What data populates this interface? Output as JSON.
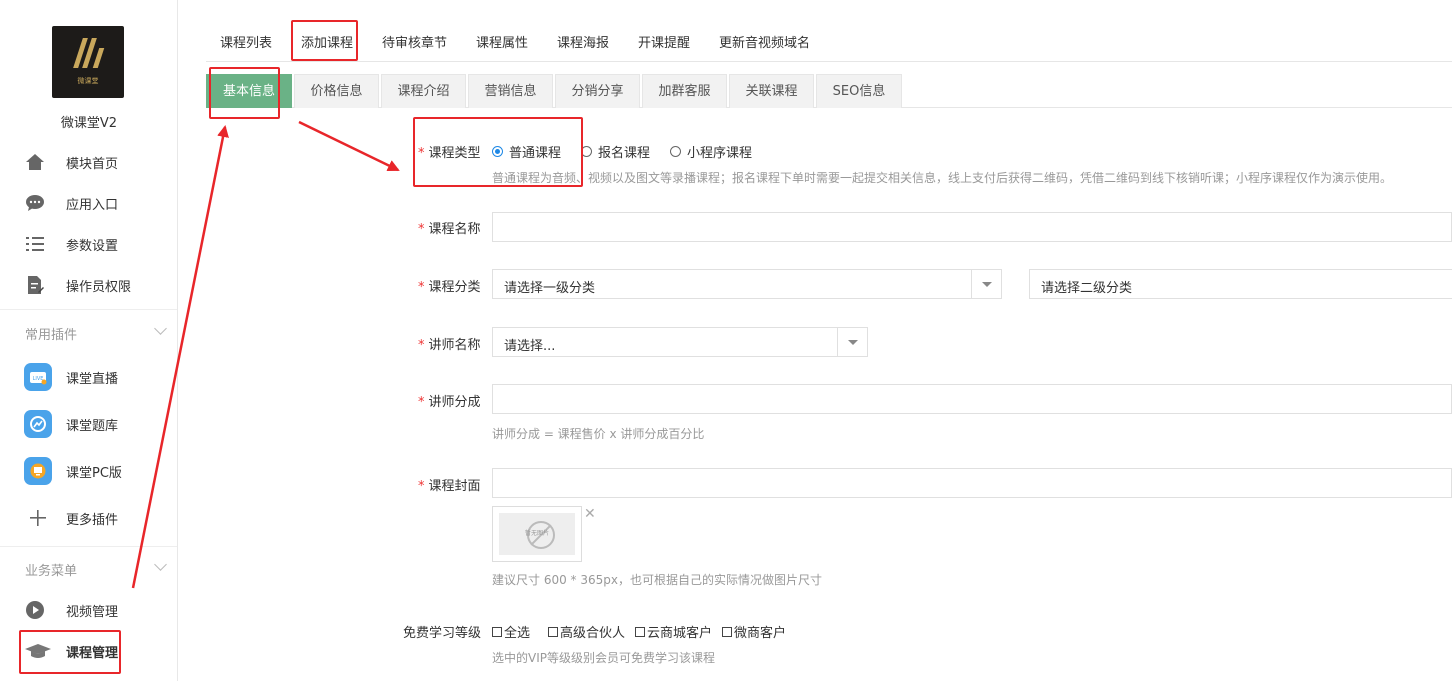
{
  "sidebar": {
    "logo_caption": "微课堂",
    "app_name": "微课堂V2",
    "main_items": [
      {
        "label": "模块首页",
        "icon": "home-icon"
      },
      {
        "label": "应用入口",
        "icon": "chat-icon"
      },
      {
        "label": "参数设置",
        "icon": "list-icon"
      },
      {
        "label": "操作员权限",
        "icon": "document-edit-icon"
      }
    ],
    "section_plugins": "常用插件",
    "plugin_items": [
      {
        "label": "课堂直播",
        "icon": "live-tv-icon"
      },
      {
        "label": "课堂题库",
        "icon": "question-bank-icon"
      },
      {
        "label": "课堂PC版",
        "icon": "monitor-icon"
      },
      {
        "label": "更多插件",
        "icon": "plus-icon"
      }
    ],
    "section_business": "业务菜单",
    "business_items": [
      {
        "label": "视频管理",
        "icon": "play-icon"
      },
      {
        "label": "课程管理",
        "icon": "graduation-cap-icon"
      }
    ]
  },
  "top_tabs": [
    "课程列表",
    "添加课程",
    "待审核章节",
    "课程属性",
    "课程海报",
    "开课提醒",
    "更新音视频域名"
  ],
  "sub_tabs": [
    "基本信息",
    "价格信息",
    "课程介绍",
    "营销信息",
    "分销分享",
    "加群客服",
    "关联课程",
    "SEO信息"
  ],
  "form": {
    "course_type": {
      "label": "课程类型",
      "options": [
        "普通课程",
        "报名课程",
        "小程序课程"
      ],
      "selected": "普通课程",
      "hint": "普通课程为音频、视频以及图文等录播课程；报名课程下单时需要一起提交相关信息，线上支付后获得二维码，凭借二维码到线下核销听课；小程序课程仅作为演示使用。"
    },
    "course_name": {
      "label": "课程名称",
      "value": ""
    },
    "category": {
      "label": "课程分类",
      "level1": "请选择一级分类",
      "level2": "请选择二级分类"
    },
    "teacher_name": {
      "label": "讲师名称",
      "value": "请选择..."
    },
    "teacher_share": {
      "label": "讲师分成",
      "value": "",
      "hint": "讲师分成 = 课程售价 x 讲师分成百分比"
    },
    "cover": {
      "label": "课程封面",
      "value": "",
      "placeholder_text": "暂无图片",
      "hint": "建议尺寸 600 * 365px，也可根据自己的实际情况做图片尺寸"
    },
    "free_level": {
      "label": "免费学习等级",
      "options": [
        "全选",
        "高级合伙人",
        "云商城客户",
        "微商客户"
      ],
      "hint": "选中的VIP等级级别会员可免费学习该课程"
    }
  },
  "colors": {
    "active_tab": "#6ab286",
    "required": "#e33333",
    "annotation": "#e8262a",
    "radio": "#1e88e5"
  }
}
